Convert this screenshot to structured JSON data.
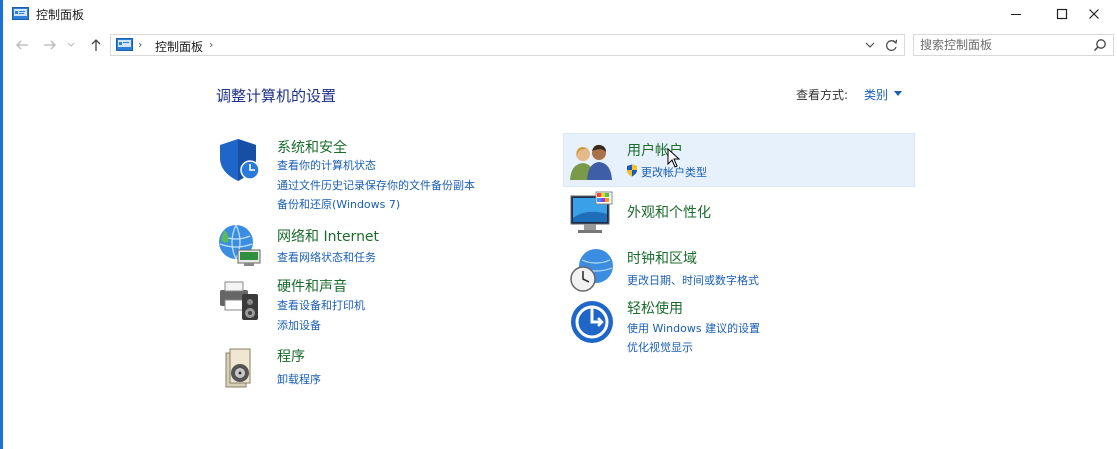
{
  "window": {
    "title": "控制面板"
  },
  "address": {
    "crumb": "控制面板",
    "search_placeholder": "搜索控制面板"
  },
  "main": {
    "heading": "调整计算机的设置",
    "view_by_label": "查看方式:",
    "view_by_value": "类别"
  },
  "categories": {
    "system_security": {
      "title": "系统和安全",
      "links": [
        "查看你的计算机状态",
        "通过文件历史记录保存你的文件备份副本",
        "备份和还原(Windows 7)"
      ]
    },
    "network": {
      "title": "网络和 Internet",
      "links": [
        "查看网络状态和任务"
      ]
    },
    "hardware": {
      "title": "硬件和声音",
      "links": [
        "查看设备和打印机",
        "添加设备"
      ]
    },
    "programs": {
      "title": "程序",
      "links": [
        "卸载程序"
      ]
    },
    "user_accounts": {
      "title": "用户帐户",
      "links": [
        "更改帐户类型"
      ]
    },
    "appearance": {
      "title": "外观和个性化",
      "links": []
    },
    "clock_region": {
      "title": "时钟和区域",
      "links": [
        "更改日期、时间或数字格式"
      ]
    },
    "ease_of_access": {
      "title": "轻松使用",
      "links": [
        "使用 Windows 建议的设置",
        "优化视觉显示"
      ]
    }
  },
  "colors": {
    "accent": "#1a5fb4",
    "category_title": "#1a6b2c",
    "heading": "#1e3287",
    "highlight": "#e7f1fb"
  },
  "icons": {
    "window": "control-panel-icon",
    "back": "arrow-left-icon",
    "forward": "arrow-right-icon",
    "up": "arrow-up-icon",
    "refresh": "refresh-icon",
    "search": "search-icon"
  }
}
